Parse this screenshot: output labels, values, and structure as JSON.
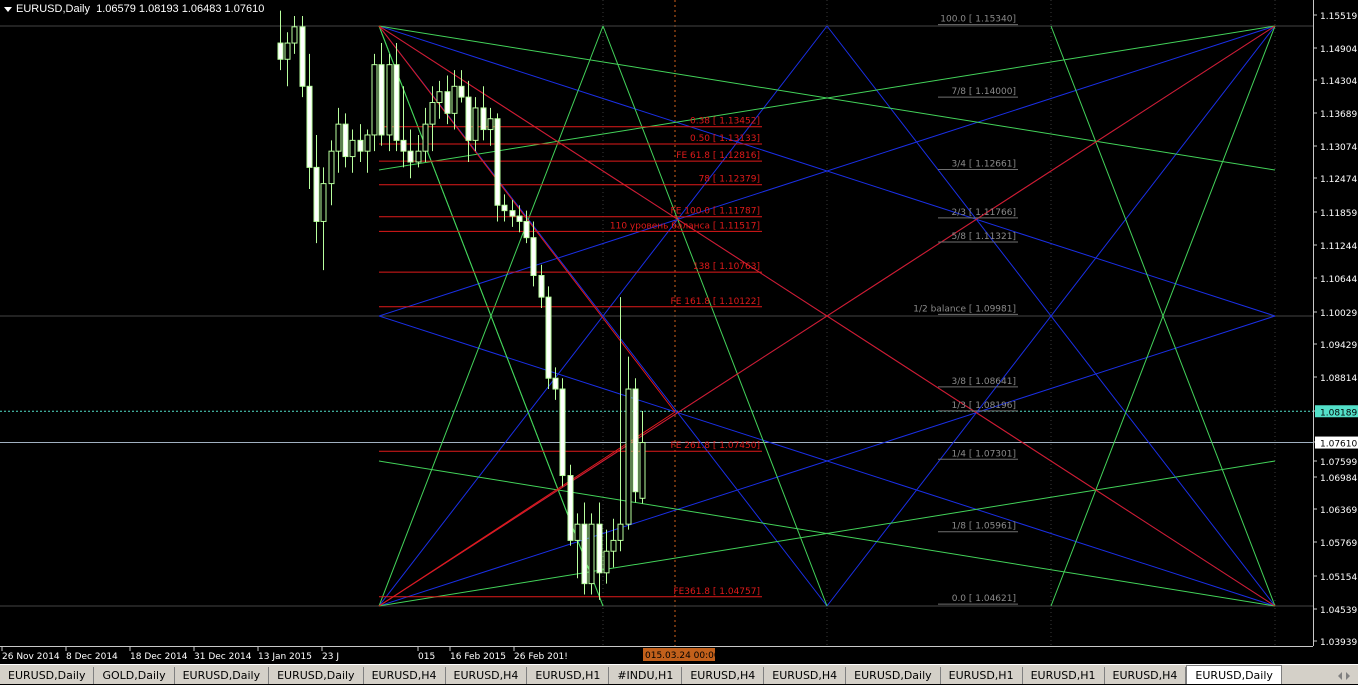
{
  "header": {
    "symbol": "EURUSD,Daily",
    "values": "1.06579 1.08193 1.06483 1.07610"
  },
  "colors": {
    "bull_candle": "#000000",
    "candle_stroke": "#b8ff9e",
    "fib_red": "#e01a1a",
    "gann_blue": "#1a2fe6",
    "gann_green": "#43d35a",
    "gann_grey": "#707070",
    "bid_marker": "#53e0c9",
    "ask_marker": "#ffffff"
  },
  "fib_levels": [
    {
      "label": "0.38",
      "value": "1.13452"
    },
    {
      "label": "0.50",
      "value": "1.13133"
    },
    {
      "label": "FE 61.8",
      "value": "1.12816"
    },
    {
      "label": "78",
      "value": "1.12379"
    },
    {
      "label": "FE 100.0",
      "value": "1.11787"
    },
    {
      "label": "110 уровень баланса",
      "value": "1.11517"
    },
    {
      "label": "138",
      "value": "1.10763"
    },
    {
      "label": "FE 161.8",
      "value": "1.10122"
    },
    {
      "label": "FE 261.8",
      "value": "1.07450"
    },
    {
      "label": "FE361.8",
      "value": "1.04757"
    }
  ],
  "gann_levels": [
    {
      "label": "100.0",
      "value": "1.15340"
    },
    {
      "label": "7/8",
      "value": "1.14000"
    },
    {
      "label": "3/4",
      "value": "1.12661"
    },
    {
      "label": "2/3",
      "value": "1.11766"
    },
    {
      "label": "5/8",
      "value": "1.11321"
    },
    {
      "label": "1/2 balance",
      "value": "1.09981"
    },
    {
      "label": "3/8",
      "value": "1.08641"
    },
    {
      "label": "1/3",
      "value": "1.08196"
    },
    {
      "label": "1/4",
      "value": "1.07301"
    },
    {
      "label": "1/8",
      "value": "1.05961"
    },
    {
      "label": "0.0",
      "value": "1.04621"
    }
  ],
  "price_axis": {
    "ticks": [
      "1.15519",
      "1.14904",
      "1.14304",
      "1.13689",
      "1.13074",
      "1.12474",
      "1.11859",
      "1.11244",
      "1.10644",
      "1.10029",
      "1.09429",
      "1.08814",
      "1.08189",
      "1.07610",
      "1.07599",
      "1.06984",
      "1.06369",
      "1.05769",
      "1.05154",
      "1.04539",
      "1.03939"
    ],
    "bid": "1.08189",
    "last": "1.07610"
  },
  "time_axis": {
    "labels": [
      "26 Nov 2014",
      "8 Dec 2014",
      "18 Dec 2014",
      "31 Dec 2014",
      "13 Jan 2015",
      "23 J",
      "015",
      "16 Feb 2015",
      "26 Feb 201!"
    ],
    "cursor_label": "015.03.24 00:00"
  },
  "tabs": [
    "EURUSD,Daily",
    "GOLD,Daily",
    "EURUSD,Daily",
    "EURUSD,Daily",
    "EURUSD,H4",
    "EURUSD,H4",
    "EURUSD,H1",
    "#INDU,H1",
    "EURUSD,H4",
    "EURUSD,H4",
    "EURUSD,Daily",
    "EURUSD,H1",
    "EURUSD,H1",
    "EURUSD,H4",
    "EURUSD,Daily"
  ],
  "active_tab": 14,
  "chart_data": {
    "type": "candlestick",
    "symbol": "EURUSD",
    "timeframe": "Daily",
    "ohlc_last": {
      "open": 1.06579,
      "high": 1.08193,
      "low": 1.06483,
      "close": 1.0761
    },
    "ylim": [
      1.03939,
      1.15519
    ],
    "candles": [
      {
        "o": 1.15,
        "h": 1.156,
        "l": 1.145,
        "c": 1.147
      },
      {
        "o": 1.147,
        "h": 1.152,
        "l": 1.142,
        "c": 1.15
      },
      {
        "o": 1.15,
        "h": 1.155,
        "l": 1.148,
        "c": 1.153
      },
      {
        "o": 1.153,
        "h": 1.155,
        "l": 1.14,
        "c": 1.142
      },
      {
        "o": 1.142,
        "h": 1.148,
        "l": 1.123,
        "c": 1.127
      },
      {
        "o": 1.127,
        "h": 1.133,
        "l": 1.113,
        "c": 1.117
      },
      {
        "o": 1.117,
        "h": 1.127,
        "l": 1.108,
        "c": 1.124
      },
      {
        "o": 1.124,
        "h": 1.132,
        "l": 1.12,
        "c": 1.13
      },
      {
        "o": 1.13,
        "h": 1.138,
        "l": 1.126,
        "c": 1.135
      },
      {
        "o": 1.135,
        "h": 1.137,
        "l": 1.127,
        "c": 1.129
      },
      {
        "o": 1.129,
        "h": 1.134,
        "l": 1.126,
        "c": 1.132
      },
      {
        "o": 1.132,
        "h": 1.135,
        "l": 1.128,
        "c": 1.13
      },
      {
        "o": 1.13,
        "h": 1.134,
        "l": 1.126,
        "c": 1.133
      },
      {
        "o": 1.133,
        "h": 1.148,
        "l": 1.13,
        "c": 1.146
      },
      {
        "o": 1.146,
        "h": 1.15,
        "l": 1.131,
        "c": 1.133
      },
      {
        "o": 1.133,
        "h": 1.148,
        "l": 1.13,
        "c": 1.146
      },
      {
        "o": 1.146,
        "h": 1.15,
        "l": 1.13,
        "c": 1.132
      },
      {
        "o": 1.132,
        "h": 1.142,
        "l": 1.127,
        "c": 1.13
      },
      {
        "o": 1.13,
        "h": 1.134,
        "l": 1.125,
        "c": 1.128
      },
      {
        "o": 1.128,
        "h": 1.133,
        "l": 1.127,
        "c": 1.13
      },
      {
        "o": 1.13,
        "h": 1.138,
        "l": 1.128,
        "c": 1.135
      },
      {
        "o": 1.135,
        "h": 1.142,
        "l": 1.13,
        "c": 1.139
      },
      {
        "o": 1.139,
        "h": 1.143,
        "l": 1.136,
        "c": 1.141
      },
      {
        "o": 1.141,
        "h": 1.144,
        "l": 1.135,
        "c": 1.137
      },
      {
        "o": 1.137,
        "h": 1.145,
        "l": 1.134,
        "c": 1.142
      },
      {
        "o": 1.142,
        "h": 1.145,
        "l": 1.139,
        "c": 1.14
      },
      {
        "o": 1.14,
        "h": 1.143,
        "l": 1.128,
        "c": 1.132
      },
      {
        "o": 1.132,
        "h": 1.14,
        "l": 1.13,
        "c": 1.138
      },
      {
        "o": 1.138,
        "h": 1.142,
        "l": 1.132,
        "c": 1.134
      },
      {
        "o": 1.134,
        "h": 1.138,
        "l": 1.131,
        "c": 1.136
      },
      {
        "o": 1.136,
        "h": 1.137,
        "l": 1.117,
        "c": 1.12
      },
      {
        "o": 1.12,
        "h": 1.122,
        "l": 1.117,
        "c": 1.119
      },
      {
        "o": 1.119,
        "h": 1.121,
        "l": 1.116,
        "c": 1.118
      },
      {
        "o": 1.118,
        "h": 1.12,
        "l": 1.115,
        "c": 1.117
      },
      {
        "o": 1.117,
        "h": 1.119,
        "l": 1.113,
        "c": 1.114
      },
      {
        "o": 1.114,
        "h": 1.117,
        "l": 1.105,
        "c": 1.107
      },
      {
        "o": 1.107,
        "h": 1.109,
        "l": 1.101,
        "c": 1.103
      },
      {
        "o": 1.103,
        "h": 1.105,
        "l": 1.086,
        "c": 1.088
      },
      {
        "o": 1.088,
        "h": 1.09,
        "l": 1.084,
        "c": 1.086
      },
      {
        "o": 1.086,
        "h": 1.088,
        "l": 1.068,
        "c": 1.07
      },
      {
        "o": 1.07,
        "h": 1.072,
        "l": 1.057,
        "c": 1.058
      },
      {
        "o": 1.058,
        "h": 1.063,
        "l": 1.051,
        "c": 1.061
      },
      {
        "o": 1.061,
        "h": 1.065,
        "l": 1.048,
        "c": 1.05
      },
      {
        "o": 1.05,
        "h": 1.063,
        "l": 1.048,
        "c": 1.061
      },
      {
        "o": 1.061,
        "h": 1.065,
        "l": 1.047,
        "c": 1.052
      },
      {
        "o": 1.052,
        "h": 1.06,
        "l": 1.05,
        "c": 1.056
      },
      {
        "o": 1.056,
        "h": 1.062,
        "l": 1.053,
        "c": 1.058
      },
      {
        "o": 1.058,
        "h": 1.103,
        "l": 1.056,
        "c": 1.061
      },
      {
        "o": 1.061,
        "h": 1.092,
        "l": 1.06,
        "c": 1.086
      },
      {
        "o": 1.086,
        "h": 1.088,
        "l": 1.065,
        "c": 1.067
      },
      {
        "o": 1.06579,
        "h": 1.08193,
        "l": 1.06483,
        "c": 1.0761
      }
    ]
  }
}
